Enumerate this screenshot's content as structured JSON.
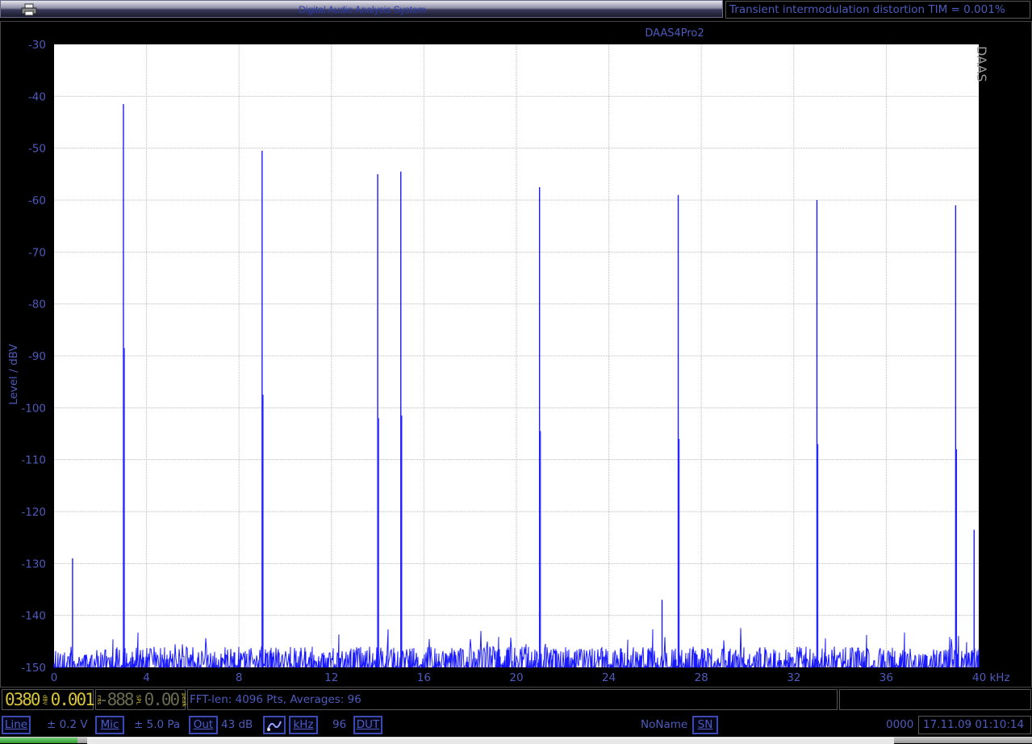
{
  "window": {
    "app_title": "Digital Audio Analysis System",
    "measurement_title": "Transient intermodulation distortion TIM = 0.001%",
    "print_icon": "printer-icon"
  },
  "chart_data": {
    "type": "line",
    "title": "DAAS4Pro2",
    "watermark": "DAAS",
    "xlabel": "kHz",
    "ylabel": "Level / dBV",
    "xlim": [
      0,
      40
    ],
    "ylim": [
      -150,
      -30
    ],
    "x_ticks": [
      "0",
      "4",
      "8",
      "12",
      "16",
      "20",
      "24",
      "28",
      "32",
      "36",
      "40 kHz"
    ],
    "y_ticks": [
      "-30",
      "-40",
      "-50",
      "-60",
      "-70",
      "-80",
      "-90",
      "-100",
      "-110",
      "-120",
      "-130",
      "-140",
      "-150"
    ],
    "grid": true,
    "noise_floor_dBV": -146,
    "series": [
      {
        "line_color": "#1a1aff",
        "peaks": [
          {
            "x": 0.8,
            "y": -129
          },
          {
            "x": 3.0,
            "y": -41.5
          },
          {
            "x": 9.0,
            "y": -50.5
          },
          {
            "x": 14.0,
            "y": -55
          },
          {
            "x": 15.0,
            "y": -54.5
          },
          {
            "x": 21.0,
            "y": -57.5
          },
          {
            "x": 26.3,
            "y": -137
          },
          {
            "x": 27.0,
            "y": -59
          },
          {
            "x": 33.0,
            "y": -60
          },
          {
            "x": 39.0,
            "y": -61
          },
          {
            "x": 39.8,
            "y": -123.5
          }
        ]
      }
    ]
  },
  "status": {
    "lcd_level": "0380",
    "lcd_level_unit": "dBV",
    "lcd_rms": "0.001",
    "lcd_rms_unit": "rms",
    "lcd_spl": "-888",
    "lcd_spl_unit": "SPL",
    "lcd_peak": "0.00",
    "lcd_peak_unit": "peak",
    "fft_info": "FFT-len: 4096 Pts, Averages: 96"
  },
  "controls": {
    "line_label": "Line",
    "line_value": "± 0.2 V",
    "mic_label": "Mic",
    "mic_value": "± 5.0 Pa",
    "out_label": "Out",
    "out_value": "43 dB",
    "khz_label": "kHz",
    "khz_value": "96",
    "dut_label": "DUT",
    "name_value": "NoName",
    "sn_label": "SN",
    "sn_value": "0000",
    "datetime": "17.11.09 01:10:14"
  }
}
